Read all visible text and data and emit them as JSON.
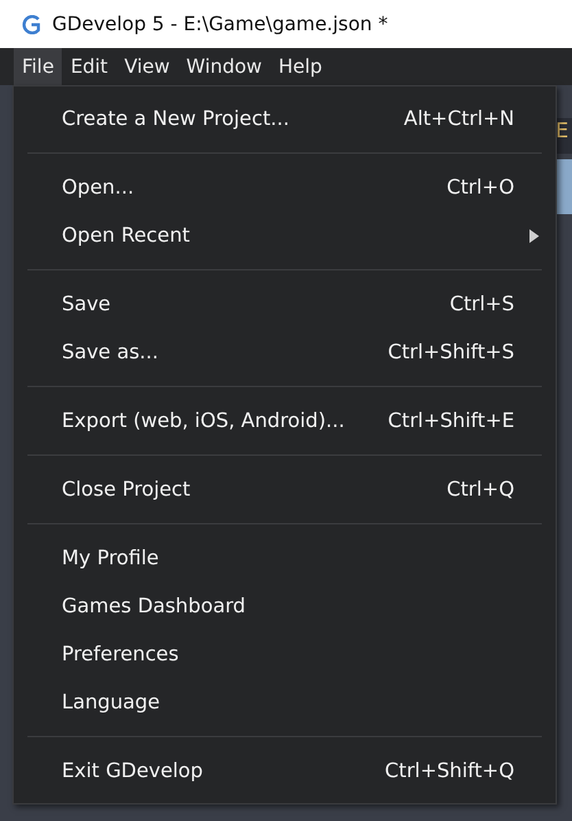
{
  "window": {
    "title": "GDevelop 5 - E:\\Game\\game.json *"
  },
  "menubar": [
    {
      "label": "File",
      "selected": true
    },
    {
      "label": "Edit",
      "selected": false
    },
    {
      "label": "View",
      "selected": false
    },
    {
      "label": "Window",
      "selected": false
    },
    {
      "label": "Help",
      "selected": false
    }
  ],
  "background": {
    "tab_label": "E"
  },
  "menu": {
    "groups": [
      [
        {
          "label": "Create a New Project...",
          "shortcut": "Alt+Ctrl+N",
          "submenu": false
        }
      ],
      [
        {
          "label": "Open...",
          "shortcut": "Ctrl+O",
          "submenu": false
        },
        {
          "label": "Open Recent",
          "submenu": true
        }
      ],
      [
        {
          "label": "Save",
          "shortcut": "Ctrl+S",
          "submenu": false
        },
        {
          "label": "Save as...",
          "shortcut": "Ctrl+Shift+S",
          "submenu": false
        }
      ],
      [
        {
          "label": "Export (web, iOS, Android)...",
          "shortcut": "Ctrl+Shift+E",
          "submenu": false
        }
      ],
      [
        {
          "label": "Close Project",
          "shortcut": "Ctrl+Q",
          "submenu": false
        }
      ],
      [
        {
          "label": "My Profile",
          "submenu": false
        },
        {
          "label": "Games Dashboard",
          "submenu": false
        },
        {
          "label": "Preferences",
          "submenu": false
        },
        {
          "label": "Language",
          "submenu": false
        }
      ],
      [
        {
          "label": "Exit GDevelop",
          "shortcut": "Ctrl+Shift+Q",
          "submenu": false
        }
      ]
    ]
  }
}
